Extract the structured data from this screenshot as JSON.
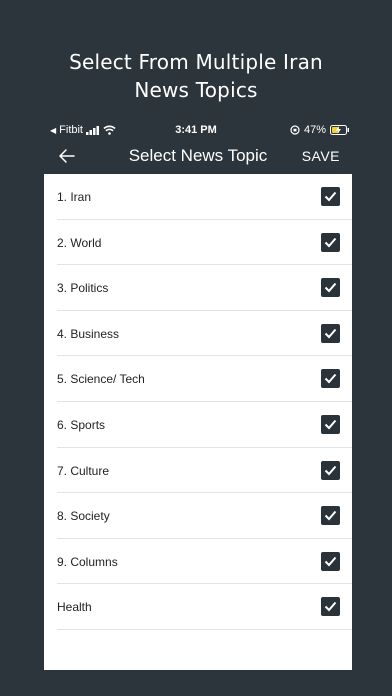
{
  "promo": {
    "line1": "Select From Multiple Iran",
    "line2": "News Topics"
  },
  "status_bar": {
    "carrier": "Fitbit",
    "time": "3:41 PM",
    "battery": "47%"
  },
  "header": {
    "title": "Select News Topic",
    "save_label": "SAVE",
    "back_icon": "arrow-left-icon"
  },
  "topics": [
    {
      "label": "1. Iran",
      "checked": true
    },
    {
      "label": "2. World",
      "checked": true
    },
    {
      "label": "3. Politics",
      "checked": true
    },
    {
      "label": "4. Business",
      "checked": true
    },
    {
      "label": "5. Science/ Tech",
      "checked": true
    },
    {
      "label": "6. Sports",
      "checked": true
    },
    {
      "label": "7. Culture",
      "checked": true
    },
    {
      "label": "8. Society",
      "checked": true
    },
    {
      "label": "9. Columns",
      "checked": true
    },
    {
      "label": "Health",
      "checked": true
    }
  ],
  "colors": {
    "background": "#2c353c",
    "checkbox": "#2a333a",
    "panel": "#ffffff"
  }
}
